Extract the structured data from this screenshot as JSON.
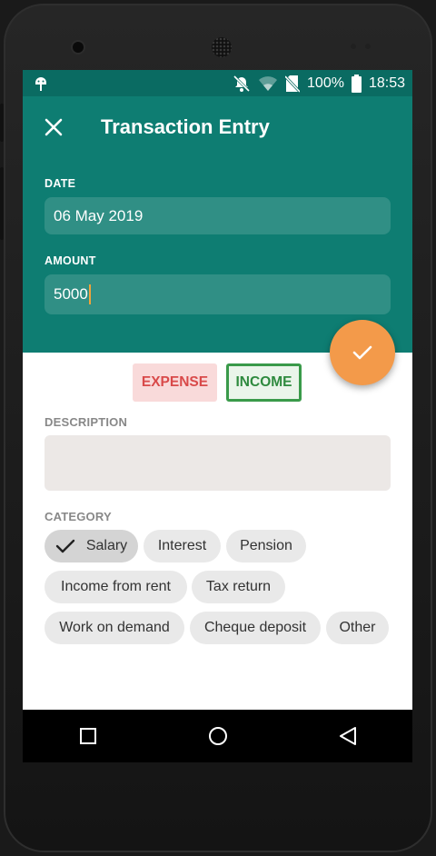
{
  "status_bar": {
    "battery": "100%",
    "time": "18:53",
    "icons": [
      "android-debug-icon",
      "notifications-off-icon",
      "wifi-icon",
      "no-sim-icon",
      "battery-icon"
    ]
  },
  "app_bar": {
    "title": "Transaction Entry",
    "close_icon": "close-icon"
  },
  "form": {
    "date_label": "DATE",
    "date_value": "06 May 2019",
    "amount_label": "AMOUNT",
    "amount_value": "5000",
    "type": {
      "expense_label": "EXPENSE",
      "income_label": "INCOME",
      "selected": "INCOME"
    },
    "description_label": "DESCRIPTION",
    "description_value": "",
    "category_label": "CATEGORY",
    "categories": [
      {
        "label": "Salary",
        "selected": true
      },
      {
        "label": "Interest",
        "selected": false
      },
      {
        "label": "Pension",
        "selected": false
      },
      {
        "label": "Income from rent",
        "selected": false
      },
      {
        "label": "Tax return",
        "selected": false
      },
      {
        "label": "Work on demand",
        "selected": false
      },
      {
        "label": "Cheque deposit",
        "selected": false
      },
      {
        "label": "Other",
        "selected": false
      }
    ]
  },
  "fab": {
    "icon": "check-icon"
  },
  "nav_bar": {
    "icons": [
      "recents-square-icon",
      "home-circle-icon",
      "back-triangle-icon"
    ]
  },
  "colors": {
    "primary": "#0e7d72",
    "primary_dark": "#0a6b62",
    "accent": "#f39a4a",
    "expense": "#d94a4a",
    "income": "#2e8a3e"
  }
}
